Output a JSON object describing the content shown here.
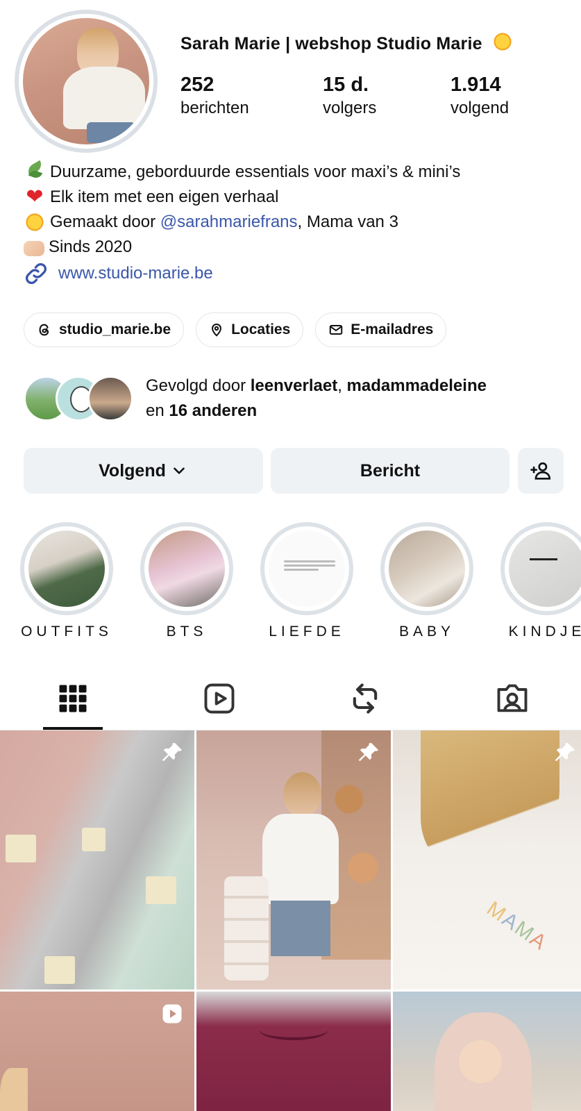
{
  "profile": {
    "name": "Sarah Marie  | webshop Studio Marie",
    "name_emoji": "sun-emoji",
    "stats": [
      {
        "value": "252",
        "label": "berichten"
      },
      {
        "value": "15 d.",
        "label": "volgers"
      },
      {
        "value": "1.914",
        "label": "volgend"
      }
    ]
  },
  "bio": {
    "line1": "Duurzame, geborduurde essentials voor maxi’s & mini’s",
    "line2": "Elk item met een eigen verhaal",
    "line3_prefix": "Gemaakt door ",
    "line3_mention": "@sarahmariefrans",
    "line3_suffix": ", Mama van 3",
    "line4": "Sinds 2020",
    "line1_emoji": "herb-emoji",
    "line2_emoji": "red-heart-emoji",
    "line3_emoji": "sun-emoji",
    "line4_emoji": "heart-hands-emoji",
    "heart_glyph": "❤",
    "website": "www.studio-marie.be"
  },
  "pills": [
    {
      "label": "studio_marie.be",
      "icon": "threads-icon"
    },
    {
      "label": "Locaties",
      "icon": "location-pin-icon"
    },
    {
      "label": "E-mailadres",
      "icon": "mail-icon"
    }
  ],
  "followed_by": {
    "prefix": "Gevolgd door ",
    "user1": "leenverlaet",
    "sep": ", ",
    "user2": "madammadeleine",
    "and": "en ",
    "others": "16 anderen"
  },
  "buttons": {
    "follow": "Volgend",
    "message": "Bericht"
  },
  "highlights": [
    {
      "label": "OUTFITS"
    },
    {
      "label": "BTS"
    },
    {
      "label": "LIEFDE"
    },
    {
      "label": "BABY"
    },
    {
      "label": "KINDJE"
    }
  ],
  "tabs": [
    "grid-icon",
    "reels-icon",
    "reposts-icon",
    "tagged-icon"
  ],
  "posts": {
    "mama_text": [
      "M",
      "A",
      "M",
      "A"
    ],
    "badges": [
      "pin-icon",
      "pin-icon",
      "pin-icon",
      "play-icon"
    ]
  },
  "colors": {
    "link": "#3a56a9",
    "button_bg": "#eff2f5",
    "ring": "#dbe0e6"
  }
}
